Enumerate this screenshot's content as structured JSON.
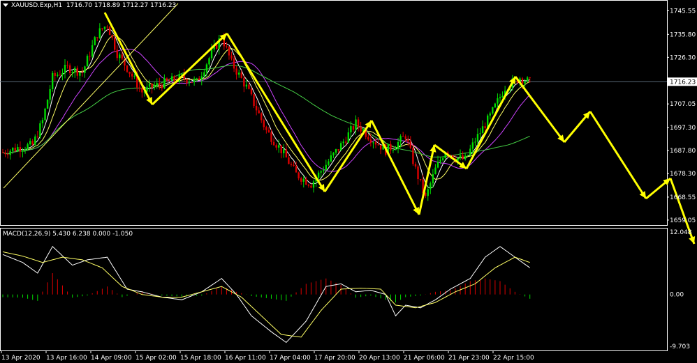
{
  "header": {
    "symbol": "XAUUSD.Exp,H1",
    "ohlc": "1716.70 1718.89 1712.27 1716.23",
    "macd_label": "MACD(12,26,9) 5.430 6.238 0.000 -1.050"
  },
  "colors": {
    "background": "#000000",
    "bull": "#00dd00",
    "bear": "#dd0000",
    "arrow": "#ffff00",
    "ma_fast": "#ffffff",
    "ma_mid": "#ffff66",
    "ma_slow": "#cc44ff",
    "ma_long": "#44cc44",
    "grid_line": "#5a6a7a"
  },
  "chart_data": [
    {
      "type": "candlestick",
      "name": "price",
      "y_ticks": [
        "1745.55",
        "1735.80",
        "1726.30",
        "1716.23",
        "1707.05",
        "1697.30",
        "1687.80",
        "1678.30",
        "1668.55",
        "1659.05"
      ],
      "ylim": [
        1657,
        1750
      ],
      "current_price": "1716.23",
      "x_ticks": [
        "13 Apr 2020",
        "13 Apr 16:00",
        "14 Apr 09:00",
        "15 Apr 02:00",
        "15 Apr 18:00",
        "16 Apr 11:00",
        "17 Apr 04:00",
        "17 Apr 20:00",
        "20 Apr 13:00",
        "21 Apr 06:00",
        "21 Apr 23:00",
        "22 Apr 15:00"
      ],
      "close_path": [
        [
          0,
          1687
        ],
        [
          6,
          1689
        ],
        [
          12,
          1690
        ],
        [
          16,
          1700
        ],
        [
          20,
          1718
        ],
        [
          26,
          1722
        ],
        [
          32,
          1720
        ],
        [
          38,
          1736
        ],
        [
          42,
          1740
        ],
        [
          46,
          1728
        ],
        [
          50,
          1722
        ],
        [
          56,
          1712
        ],
        [
          60,
          1714
        ],
        [
          66,
          1716
        ],
        [
          72,
          1718
        ],
        [
          78,
          1716
        ],
        [
          84,
          1728
        ],
        [
          88,
          1735
        ],
        [
          92,
          1724
        ],
        [
          98,
          1714
        ],
        [
          106,
          1696
        ],
        [
          112,
          1688
        ],
        [
          118,
          1678
        ],
        [
          124,
          1674
        ],
        [
          130,
          1682
        ],
        [
          136,
          1690
        ],
        [
          142,
          1699
        ],
        [
          148,
          1693
        ],
        [
          154,
          1688
        ],
        [
          158,
          1690
        ],
        [
          162,
          1694
        ],
        [
          166,
          1680
        ],
        [
          170,
          1668
        ],
        [
          174,
          1680
        ],
        [
          178,
          1688
        ],
        [
          182,
          1685
        ],
        [
          186,
          1684
        ],
        [
          190,
          1692
        ],
        [
          196,
          1702
        ],
        [
          202,
          1714
        ],
        [
          208,
          1718
        ],
        [
          212,
          1716
        ]
      ],
      "macd_y_ticks": [
        "12.048",
        "0.00",
        "-9.703"
      ],
      "macd_ylim": [
        -10.5,
        12.5
      ],
      "macd_main": [
        [
          0,
          7.5
        ],
        [
          8,
          6
        ],
        [
          14,
          4
        ],
        [
          20,
          9
        ],
        [
          28,
          5.5
        ],
        [
          34,
          6.5
        ],
        [
          42,
          7
        ],
        [
          50,
          1
        ],
        [
          56,
          0.5
        ],
        [
          64,
          -0.5
        ],
        [
          72,
          -1
        ],
        [
          80,
          0.5
        ],
        [
          88,
          3
        ],
        [
          94,
          0
        ],
        [
          100,
          -4
        ],
        [
          108,
          -7
        ],
        [
          114,
          -9
        ],
        [
          122,
          -5
        ],
        [
          130,
          1.5
        ],
        [
          136,
          2
        ],
        [
          142,
          0.5
        ],
        [
          148,
          0.8
        ],
        [
          154,
          0
        ],
        [
          158,
          -4
        ],
        [
          162,
          -2
        ],
        [
          168,
          -2.5
        ],
        [
          174,
          -1
        ],
        [
          180,
          1
        ],
        [
          188,
          3
        ],
        [
          194,
          7
        ],
        [
          200,
          9
        ],
        [
          206,
          7
        ],
        [
          212,
          5
        ]
      ],
      "macd_signal": [
        [
          0,
          8
        ],
        [
          8,
          7.2
        ],
        [
          16,
          6
        ],
        [
          24,
          7
        ],
        [
          32,
          6.5
        ],
        [
          40,
          5
        ],
        [
          48,
          1.5
        ],
        [
          56,
          0
        ],
        [
          64,
          -0.5
        ],
        [
          72,
          -0.5
        ],
        [
          80,
          0.5
        ],
        [
          88,
          1.5
        ],
        [
          96,
          -0.5
        ],
        [
          104,
          -4
        ],
        [
          112,
          -7.5
        ],
        [
          120,
          -8
        ],
        [
          128,
          -3
        ],
        [
          136,
          1
        ],
        [
          144,
          1.2
        ],
        [
          152,
          1
        ],
        [
          158,
          -2
        ],
        [
          166,
          -2.5
        ],
        [
          174,
          -1.5
        ],
        [
          182,
          0.5
        ],
        [
          190,
          2
        ],
        [
          198,
          5
        ],
        [
          206,
          7
        ],
        [
          212,
          6
        ]
      ],
      "macd_hist": [
        [
          0,
          -0.5
        ],
        [
          8,
          -0.6
        ],
        [
          14,
          -1.2
        ],
        [
          20,
          4
        ],
        [
          28,
          -0.6
        ],
        [
          34,
          -0.2
        ],
        [
          42,
          1.5
        ],
        [
          48,
          -0.5
        ],
        [
          56,
          0.5
        ],
        [
          64,
          -0.2
        ],
        [
          72,
          -0.4
        ],
        [
          80,
          -0.2
        ],
        [
          88,
          1.5
        ],
        [
          94,
          0.5
        ],
        [
          100,
          -0.3
        ],
        [
          108,
          -0.8
        ],
        [
          114,
          -1.2
        ],
        [
          122,
          2
        ],
        [
          130,
          3
        ],
        [
          136,
          1.8
        ],
        [
          142,
          -0.6
        ],
        [
          148,
          -0.2
        ],
        [
          154,
          -1
        ],
        [
          158,
          -1.5
        ],
        [
          162,
          -0.5
        ],
        [
          168,
          -0.2
        ],
        [
          174,
          0.5
        ],
        [
          180,
          0.8
        ],
        [
          188,
          2.5
        ],
        [
          194,
          3
        ],
        [
          200,
          2.5
        ],
        [
          206,
          0.5
        ],
        [
          212,
          -0.8
        ]
      ]
    }
  ]
}
